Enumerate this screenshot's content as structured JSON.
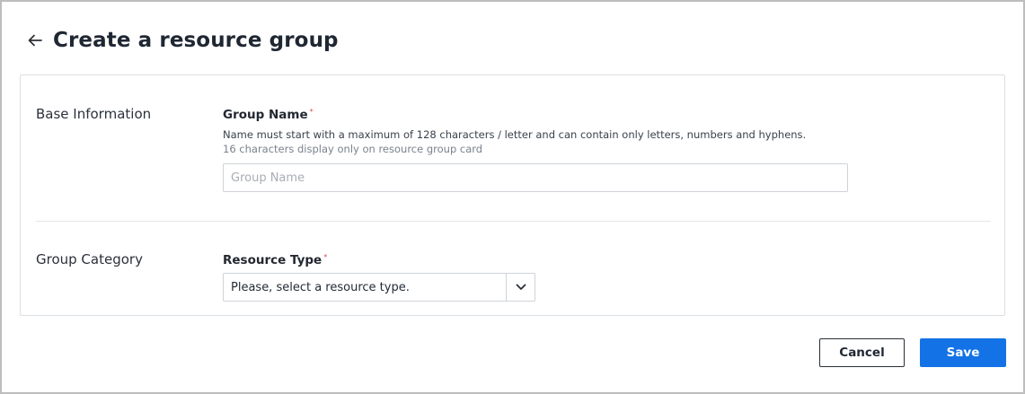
{
  "header": {
    "title": "Create a resource group",
    "back_icon": "arrow-left-icon"
  },
  "sections": {
    "base": {
      "label": "Base Information",
      "group_name": {
        "label": "Group Name",
        "required_mark": "*",
        "help_text": "Name must start with a maximum of 128 characters / letter and can contain only letters, numbers and hyphens.",
        "help_count_text": "16 characters display only on resource group card",
        "placeholder": "Group Name",
        "value": ""
      }
    },
    "category": {
      "label": "Group Category",
      "resource_type": {
        "label": "Resource Type",
        "required_mark": "*",
        "selected": "Please, select a resource type.",
        "arrow_icon": "chevron-down-icon"
      }
    }
  },
  "footer": {
    "cancel_label": "Cancel",
    "save_label": "Save"
  },
  "colors": {
    "primary": "#1373e6",
    "required": "#e54848",
    "border": "#cfd3d8"
  }
}
